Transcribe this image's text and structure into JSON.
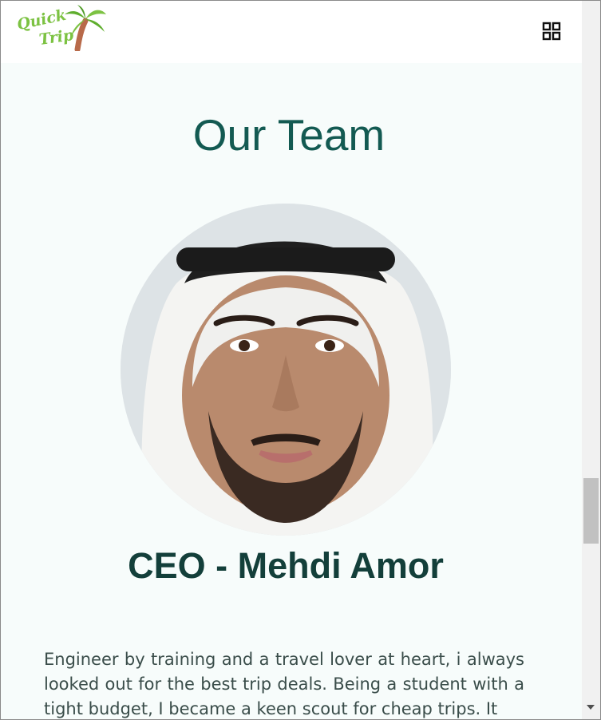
{
  "header": {
    "logo_line1": "Quick",
    "logo_line2": "Trip",
    "menu_icon": "grid-menu-icon"
  },
  "team": {
    "title": "Our Team",
    "member": {
      "name": "CEO - Mehdi Amor",
      "photo_icon": "portrait-photo",
      "bio": "Engineer by training and a travel lover at heart, i always looked out for the best trip deals. Being a student with a tight budget, I became a keen scout for cheap trips. It"
    }
  },
  "colors": {
    "accent": "#135a52",
    "name_color": "#133f3a",
    "logo_green": "#7cc242",
    "background": "#f7fcfb"
  }
}
